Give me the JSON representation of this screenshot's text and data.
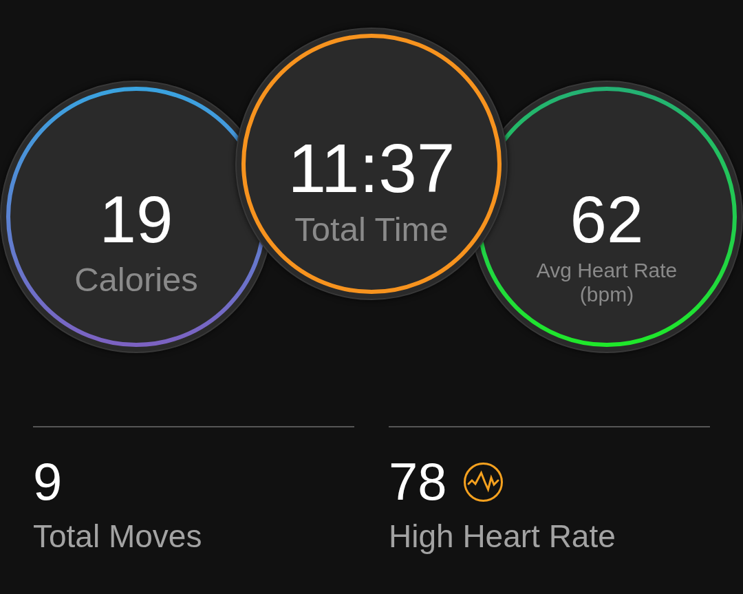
{
  "dials": [
    {
      "value": "19",
      "label": "Calories",
      "ring_stops": [
        {
          "color": "#3aa3e0"
        },
        {
          "color": "#7c62c2"
        }
      ]
    },
    {
      "value": "11:37",
      "label": "Total Time",
      "ring_stops": [
        {
          "color": "#f7931e"
        }
      ]
    },
    {
      "value": "62",
      "label": "Avg Heart Rate",
      "unit": "(bpm)",
      "ring_stops": [
        {
          "color": "#24b173"
        },
        {
          "color": "#1fe82a"
        }
      ]
    }
  ],
  "stats": [
    {
      "value": "9",
      "label": "Total Moves",
      "alert": false
    },
    {
      "value": "78",
      "label": "High Heart Rate",
      "alert": true
    }
  ]
}
